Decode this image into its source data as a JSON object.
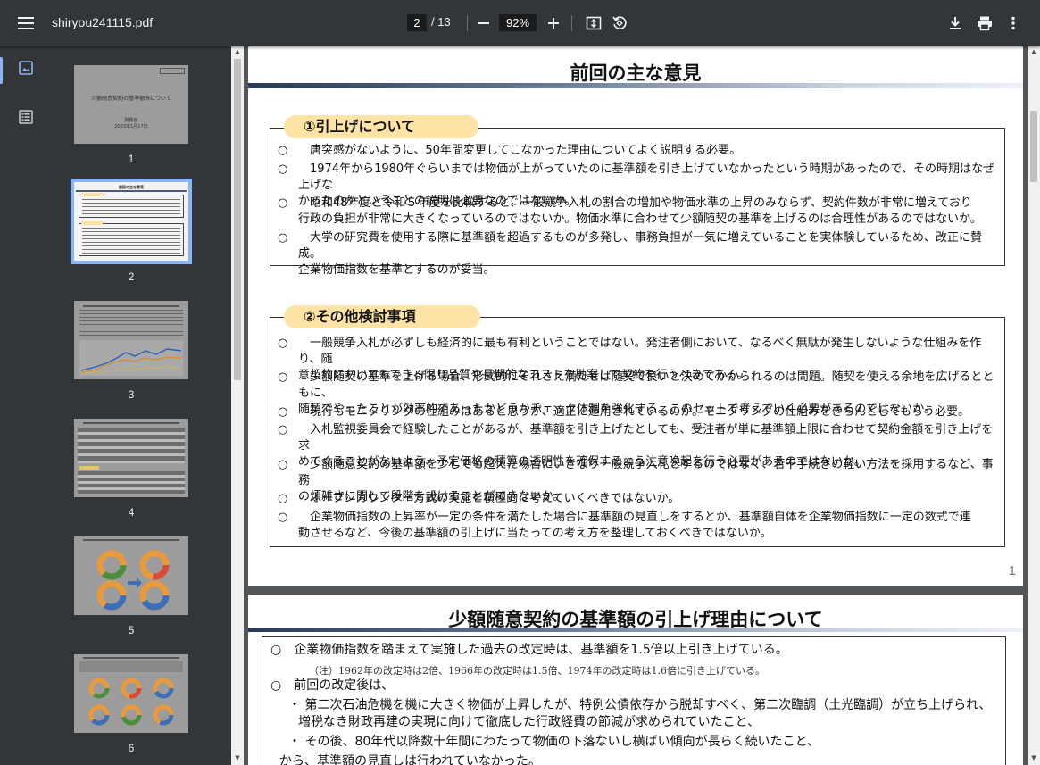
{
  "toolbar": {
    "filename": "shiryou241115.pdf",
    "current_page": "2",
    "total_pages": "/ 13",
    "zoom": "92%"
  },
  "sidebar": {
    "thumbnails": [
      {
        "num": "1",
        "preview_title": "少額随意契約の基準額等について",
        "preview_sub": "財務省",
        "preview_date": "2023年1月17日"
      },
      {
        "num": "2",
        "preview_title": "前回の主な意見"
      },
      {
        "num": "3"
      },
      {
        "num": "4"
      },
      {
        "num": "5"
      },
      {
        "num": "6"
      }
    ]
  },
  "page1": {
    "title": "前回の主な意見",
    "section1": {
      "heading": "①引上げについて",
      "items": [
        {
          "mark": "○",
          "lines": [
            "　唐突感がないように、50年間変更してこなかった理由についてよく説明する必要。"
          ]
        },
        {
          "mark": "○",
          "lines": [
            "　1974年から1980年ぐらいまでは物価が上がっていたのに基準額を引き上げていなかったという時期があったので、その時期はなぜ上げな",
            "かったのかということの説明は必要なのではないか。"
          ]
        },
        {
          "mark": "○",
          "lines": [
            "　昭和48年度と令和５年度を比較すると、一般競争入札の割合の増加や物価水準の上昇のみならず、契約件数が非常に増えており",
            "行政の負担が非常に大きくなっているのではないか。物価水準に合わせて少額随契の基準を上げるのは合理性があるのではないか。"
          ]
        },
        {
          "mark": "○",
          "lines": [
            "　大学の研究費を使用する際に基準額を超過するものが多発し、事務負担が一気に増えていることを実体験しているため、改正に賛成。",
            "企業物価指数を基準とするのが妥当。"
          ]
        }
      ]
    },
    "section2": {
      "heading": "②その他検討事項",
      "items": [
        {
          "mark": "○",
          "lines": [
            "　一般競争入札が必ずしも経済的に最も有利ということではない。発注者側において、なるべく無駄が発生しないような仕組みを作り、随",
            "意契約においてもできる限り品質や長期的なコストを勘案して契約を行うべきである。"
          ]
        },
        {
          "mark": "○",
          "lines": [
            "　少額随契の基準を上げる場合、形式的にそれさえ満たせば随契で良いと決めてかかられるのは問題。随契を使える余地を広げるとともに、",
            "随契でやったことが効率的であったかどうかチェック体制を強化する。このセットで考えていく必要があるのではないか。"
          ]
        },
        {
          "mark": "○",
          "lines": [
            "　現行もモニタリングの仕組みはあると思うが、適正に運用されているのか。モニタリングの仕組みをきちんとしてもらう必要。"
          ]
        },
        {
          "mark": "○",
          "lines": [
            "　入札監視委員会で経験したことがあるが、基準額を引き上げたとしても、受注者が単に基準額上限に合わせて契約金額を引き上げを求",
            "めてくることがないよう、予定価格の積算の透明性を確保するよう注意喚起を行う必要があるのではないか。"
          ]
        },
        {
          "mark": "○",
          "lines": [
            "　少額随意契約の基準額を少しでも超えた場合にいきなり一般競争入札とするのではなく、若干手続きの軽い方法を採用するなど、事務",
            "の煩雑さに関して段階を設けることができないか。"
          ]
        },
        {
          "mark": "○",
          "lines": [
            "　オープンカウンター方式の実施を積極的に考えていくべきではないか。"
          ]
        },
        {
          "mark": "○",
          "lines": [
            "　企業物価指数の上昇率が一定の条件を満たした場合に基準額の見直しをするとか、基準額自体を企業物価指数に一定の数式で連",
            "動させるなど、今後の基準額の引上げに当たっての考え方を整理しておくべきではないか。"
          ]
        }
      ]
    },
    "page_number": "1"
  },
  "page2": {
    "title": "少額随意契約の基準額の引上げ理由について",
    "item1": "○　企業物価指数を踏まえて実施した過去の改定時は、基準額を1.5倍以上引き上げている。",
    "note": "（注）1962年の改定時は2倍、1966年の改定時は1.5倍、1974年の改定時は1.6倍に引き上げている。",
    "item2": "○　前回の改定後は、",
    "bullet1a": "・ 第二次石油危機を機に大きく物価が上昇したが、特例公債依存から脱却すべく、第二次臨調（土光臨調）が立ち上げられ、",
    "bullet1b": "増税なき財政再建の実現に向けて徹底した行政経費の節減が求められていたこと、",
    "bullet2": "・ その後、80年代以降数十年間にわたって物価の下落ないし横ばい傾向が長らく続いたこと、",
    "tail": "から、基準額の見直しは行われていなかった。"
  }
}
